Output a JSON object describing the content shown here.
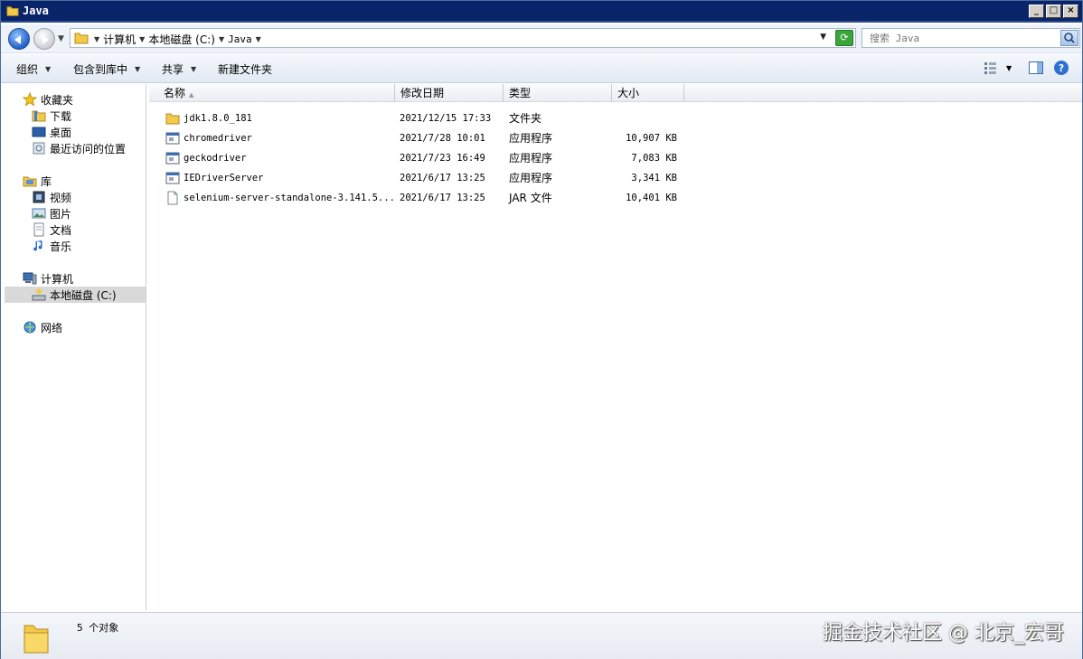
{
  "window": {
    "title": "Java",
    "buttons": [
      "_",
      "□",
      "×"
    ]
  },
  "address": {
    "crumbs": [
      "计算机",
      "本地磁盘 (C:)",
      "Java"
    ],
    "search_placeholder": "搜索 Java"
  },
  "toolbar": {
    "organize": "组织",
    "include_in_library": "包含到库中",
    "share": "共享",
    "new_folder": "新建文件夹"
  },
  "navpane": {
    "favorites": "收藏夹",
    "downloads": "下载",
    "desktop": "桌面",
    "recent": "最近访问的位置",
    "libraries": "库",
    "videos": "视频",
    "pictures": "图片",
    "documents": "文档",
    "music": "音乐",
    "computer": "计算机",
    "local_disk": "本地磁盘 (C:)",
    "network": "网络"
  },
  "columns": {
    "name": "名称",
    "modified": "修改日期",
    "type": "类型",
    "size": "大小"
  },
  "files": [
    {
      "name": "jdk1.8.0_181",
      "modified": "2021/12/15 17:33",
      "type": "文件夹",
      "size": "",
      "icon": "folder-icon"
    },
    {
      "name": "chromedriver",
      "modified": "2021/7/28 10:01",
      "type": "应用程序",
      "size": "10,907 KB",
      "icon": "application-icon"
    },
    {
      "name": "geckodriver",
      "modified": "2021/7/23 16:49",
      "type": "应用程序",
      "size": "7,083 KB",
      "icon": "application-icon"
    },
    {
      "name": "IEDriverServer",
      "modified": "2021/6/17 13:25",
      "type": "应用程序",
      "size": "3,341 KB",
      "icon": "application-icon"
    },
    {
      "name": "selenium-server-standalone-3.141.5...",
      "modified": "2021/6/17 13:25",
      "type": "JAR 文件",
      "size": "10,401 KB",
      "icon": "file-icon"
    }
  ],
  "status": {
    "count_text": "5 个对象",
    "watermark": "掘金技术社区 @ 北京_宏哥"
  }
}
